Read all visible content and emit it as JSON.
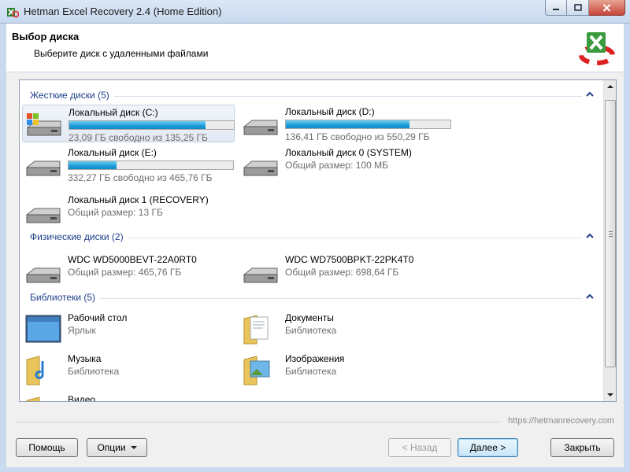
{
  "window": {
    "title": "Hetman Excel Recovery 2.4 (Home Edition)",
    "caption_buttons": [
      "minimize-icon",
      "maximize-icon",
      "close-icon"
    ]
  },
  "header": {
    "title": "Выбор диска",
    "subtitle": "Выберите диск с удаленными файлами",
    "logo_icon": "excel-recovery-logo"
  },
  "groups": {
    "hard": {
      "title": "Жесткие диски (5)",
      "items": [
        {
          "name": "Локальный диск (C:)",
          "sub": "23,09 ГБ свободно из 135,25 ГБ",
          "used_fraction": 0.83,
          "icon": "system-drive-icon",
          "selected": true
        },
        {
          "name": "Локальный диск (D:)",
          "sub": "136,41 ГБ свободно из 550,29 ГБ",
          "used_fraction": 0.75,
          "icon": "hard-drive-icon"
        },
        {
          "name": "Локальный диск (E:)",
          "sub": "332,27 ГБ свободно из 465,76 ГБ",
          "used_fraction": 0.29,
          "icon": "hard-drive-icon"
        },
        {
          "name": "Локальный диск 0 (SYSTEM)",
          "sub": "Общий размер: 100 МБ",
          "icon": "hard-drive-icon"
        },
        {
          "name": "Локальный диск 1 (RECOVERY)",
          "sub": "Общий размер: 13 ГБ",
          "icon": "hard-drive-icon"
        }
      ]
    },
    "physical": {
      "title": "Физические диски (2)",
      "items": [
        {
          "name": "WDC WD5000BEVT-22A0RT0",
          "sub": "Общий размер: 465,76 ГБ",
          "icon": "hard-drive-icon"
        },
        {
          "name": "WDC WD7500BPKT-22PK4T0",
          "sub": "Общий размер: 698,64 ГБ",
          "icon": "hard-drive-icon"
        }
      ]
    },
    "libraries": {
      "title": "Библиотеки (5)",
      "items": [
        {
          "name": "Рабочий стол",
          "sub": "Ярлык",
          "icon": "desktop-icon"
        },
        {
          "name": "Документы",
          "sub": "Библиотека",
          "icon": "documents-folder-icon"
        },
        {
          "name": "Музыка",
          "sub": "Библиотека",
          "icon": "music-folder-icon"
        },
        {
          "name": "Изображения",
          "sub": "Библиотека",
          "icon": "pictures-folder-icon"
        },
        {
          "name": "Видео",
          "sub": "",
          "icon": "video-folder-icon"
        }
      ]
    }
  },
  "footer": {
    "url": "https://hetmanrecovery.com",
    "help_label": "Помощь",
    "options_label": "Опции",
    "back_label": "< Назад",
    "next_label": "Далее >",
    "close_label": "Закрыть"
  },
  "colors": {
    "progress": "#1c9bd9",
    "group_title": "#1e3f8a",
    "frame": "#c9daf0"
  }
}
